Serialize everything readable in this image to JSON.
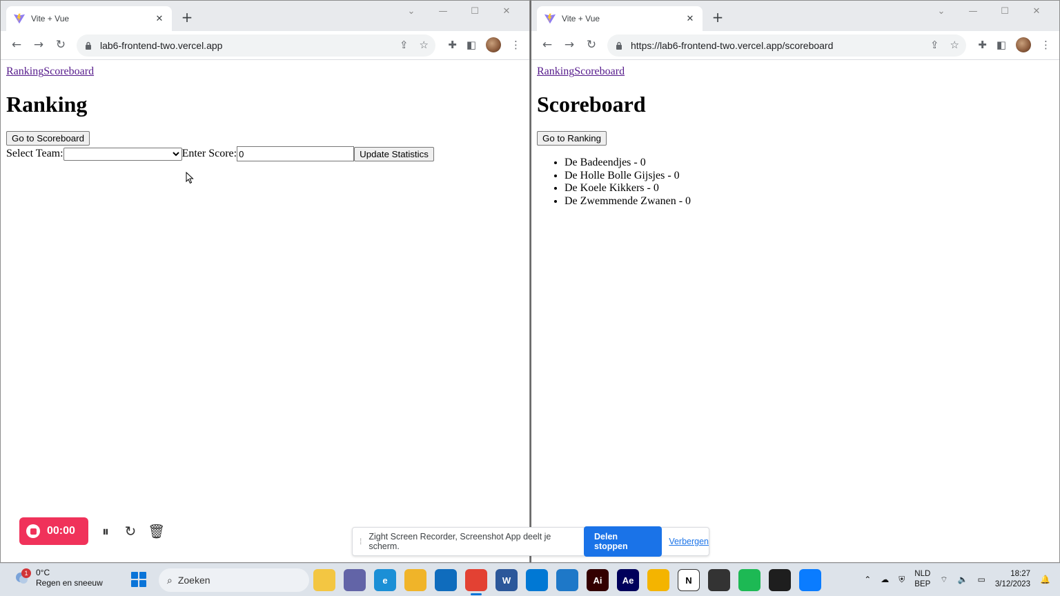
{
  "left_window": {
    "tab_title": "Vite + Vue",
    "url": "lab6-frontend-two.vercel.app",
    "nav_links": [
      "Ranking",
      "Scoreboard"
    ],
    "heading": "Ranking",
    "go_button": "Go to Scoreboard",
    "select_label": "Select Team:",
    "select_value": "",
    "score_label": "Enter Score:",
    "score_value": "0",
    "update_button": "Update Statistics"
  },
  "right_window": {
    "tab_title": "Vite + Vue",
    "url": "https://lab6-frontend-two.vercel.app/scoreboard",
    "nav_links": [
      "Ranking",
      "Scoreboard"
    ],
    "heading": "Scoreboard",
    "go_button": "Go to Ranking",
    "teams": [
      "De Badeendjes - 0",
      "De Holle Bolle Gijsjes - 0",
      "De Koele Kikkers - 0",
      "De Zwemmende Zwanen - 0"
    ]
  },
  "recorder": {
    "timer": "00:00"
  },
  "share_bar": {
    "message": "Zight Screen Recorder, Screenshot App deelt je scherm.",
    "stop_label": "Delen stoppen",
    "hide_label": "Verbergen"
  },
  "taskbar": {
    "weather_badge": "1",
    "temperature": "0°C",
    "weather_desc": "Regen en sneeuw",
    "search_placeholder": "Zoeken",
    "lang_top": "NLD",
    "lang_bottom": "BEP",
    "time": "18:27",
    "date": "3/12/2023",
    "apps": [
      {
        "name": "file-explorer-app-icon",
        "label": "",
        "color": "#f3c642"
      },
      {
        "name": "teams-app-icon",
        "label": "",
        "color": "#6264a7"
      },
      {
        "name": "edge-app-icon",
        "label": "e",
        "color": "#1b8fd6"
      },
      {
        "name": "folder-app-icon",
        "label": "",
        "color": "#f0b429"
      },
      {
        "name": "mail-app-icon",
        "label": "",
        "color": "#0f6cbd"
      },
      {
        "name": "chrome-app-icon",
        "label": "",
        "color": "#e34133"
      },
      {
        "name": "word-app-icon",
        "label": "W",
        "color": "#2b579a"
      },
      {
        "name": "vscode-app-icon",
        "label": "",
        "color": "#0078d4"
      },
      {
        "name": "store-app-icon",
        "label": "",
        "color": "#1e78c8"
      },
      {
        "name": "illustrator-app-icon",
        "label": "Ai",
        "color": "#330000"
      },
      {
        "name": "after-effects-app-icon",
        "label": "Ae",
        "color": "#00005b"
      },
      {
        "name": "chrome-canary-app-icon",
        "label": "",
        "color": "#f4b400"
      },
      {
        "name": "notion-app-icon",
        "label": "N",
        "color": "#ffffff"
      },
      {
        "name": "sticky-notes-app-icon",
        "label": "",
        "color": "#333333"
      },
      {
        "name": "spotify-app-icon",
        "label": "",
        "color": "#1db954"
      },
      {
        "name": "figma-app-icon",
        "label": "",
        "color": "#1e1e1e"
      },
      {
        "name": "messenger-app-icon",
        "label": "",
        "color": "#0a7cff"
      }
    ]
  }
}
